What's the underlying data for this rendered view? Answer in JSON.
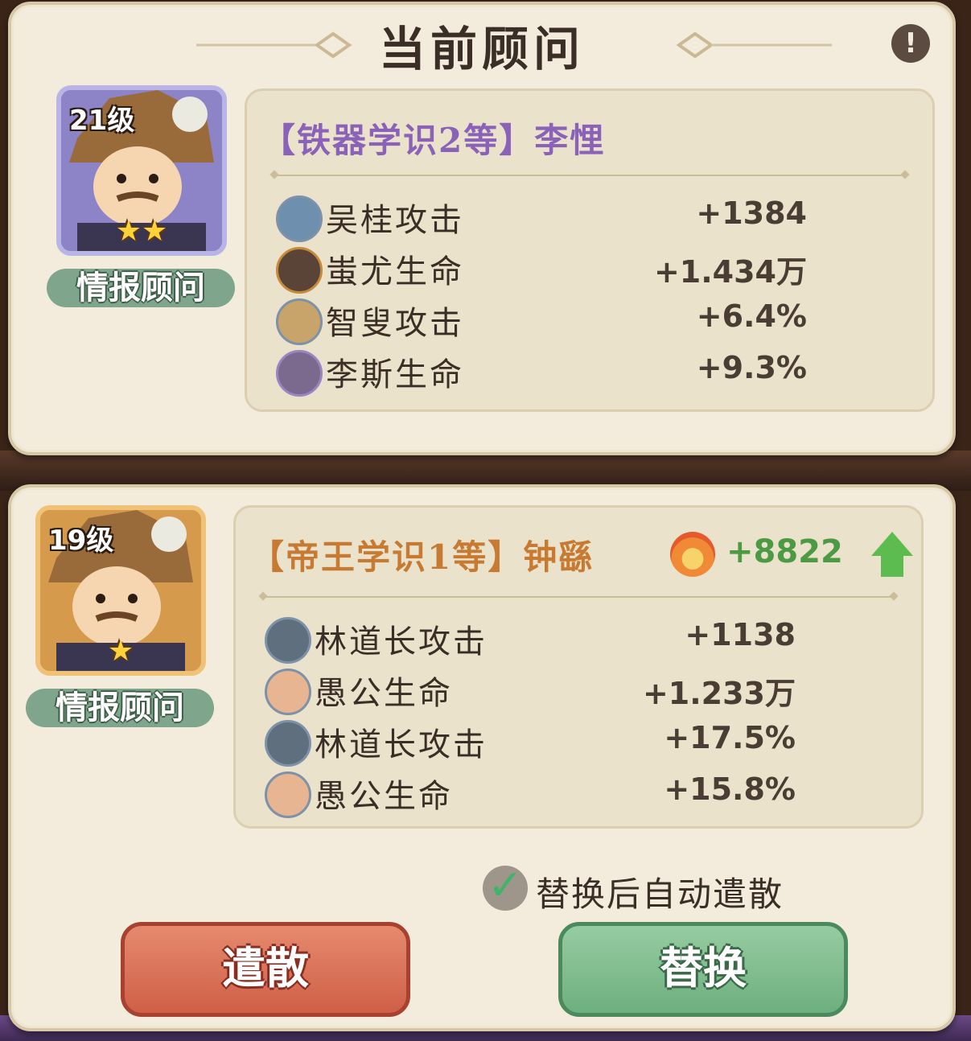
{
  "title": "当前顾问",
  "current_advisor": {
    "level": "21级",
    "stars": "★★",
    "role": "情报顾问",
    "name_label": "【铁器学识2等】李悝",
    "name_color": "#8a62b8",
    "stats": [
      {
        "icon": "wu-gui-portrait-icon",
        "name": "吴桂攻击",
        "value": "+1384"
      },
      {
        "icon": "chi-you-portrait-icon",
        "name": "蚩尤生命",
        "value": "+1.434万"
      },
      {
        "icon": "zhi-sou-portrait-icon",
        "name": "智叟攻击",
        "value": "+6.4%"
      },
      {
        "icon": "li-si-portrait-icon",
        "name": "李斯生命",
        "value": "+9.3%"
      }
    ]
  },
  "candidate_advisor": {
    "level": "19级",
    "stars": "★",
    "role": "情报顾问",
    "name_label": "【帝王学识1等】钟繇",
    "name_color": "#c77a32",
    "power_value": "+8822",
    "power_icon": "fire-power-icon",
    "stats": [
      {
        "icon": "lin-daozhang-portrait-icon",
        "name": "林道长攻击",
        "value": "+1138"
      },
      {
        "icon": "yu-gong-portrait-icon",
        "name": "愚公生命",
        "value": "+1.233万"
      },
      {
        "icon": "lin-daozhang-portrait-icon",
        "name": "林道长攻击",
        "value": "+17.5%"
      },
      {
        "icon": "yu-gong-portrait-icon",
        "name": "愚公生命",
        "value": "+15.8%"
      }
    ]
  },
  "auto_dismiss": {
    "checked": true,
    "label": "替换后自动遣散"
  },
  "buttons": {
    "dismiss": "遣散",
    "replace": "替换"
  },
  "info_icon": "!",
  "colors": {
    "panel": "#f3ecdc",
    "dismiss_button": "#d96a50",
    "replace_button": "#7db88b",
    "power_green": "#4c9a44"
  }
}
